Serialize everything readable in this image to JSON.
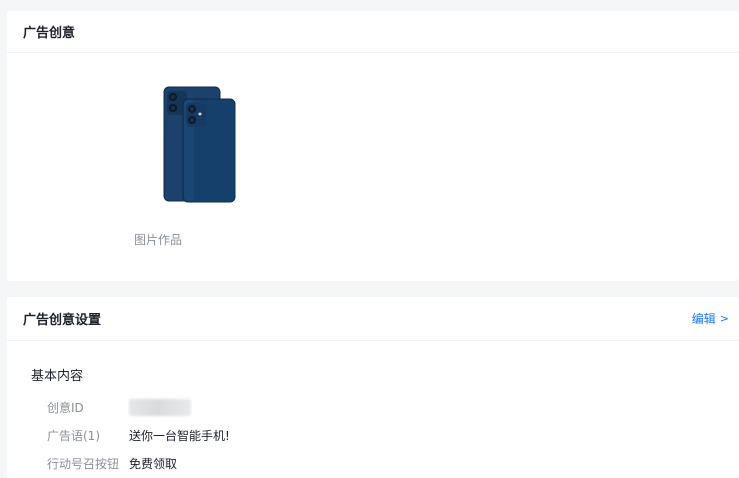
{
  "creative": {
    "title": "广告创意",
    "item_caption": "图片作品",
    "image_icon": "phone-product-image"
  },
  "settings": {
    "title": "广告创意设置",
    "edit_label": "编辑",
    "edit_chevron": ">",
    "subtitle": "基本内容",
    "rows": [
      {
        "label": "创意ID",
        "value": ""
      },
      {
        "label": "广告语(1)",
        "value": "送你一台智能手机!"
      },
      {
        "label": "行动号召按钮",
        "value": "免费领取"
      }
    ]
  },
  "colors": {
    "accent": "#1677ff",
    "phone_body": "#153a63",
    "page_bg": "#f5f6f7"
  }
}
